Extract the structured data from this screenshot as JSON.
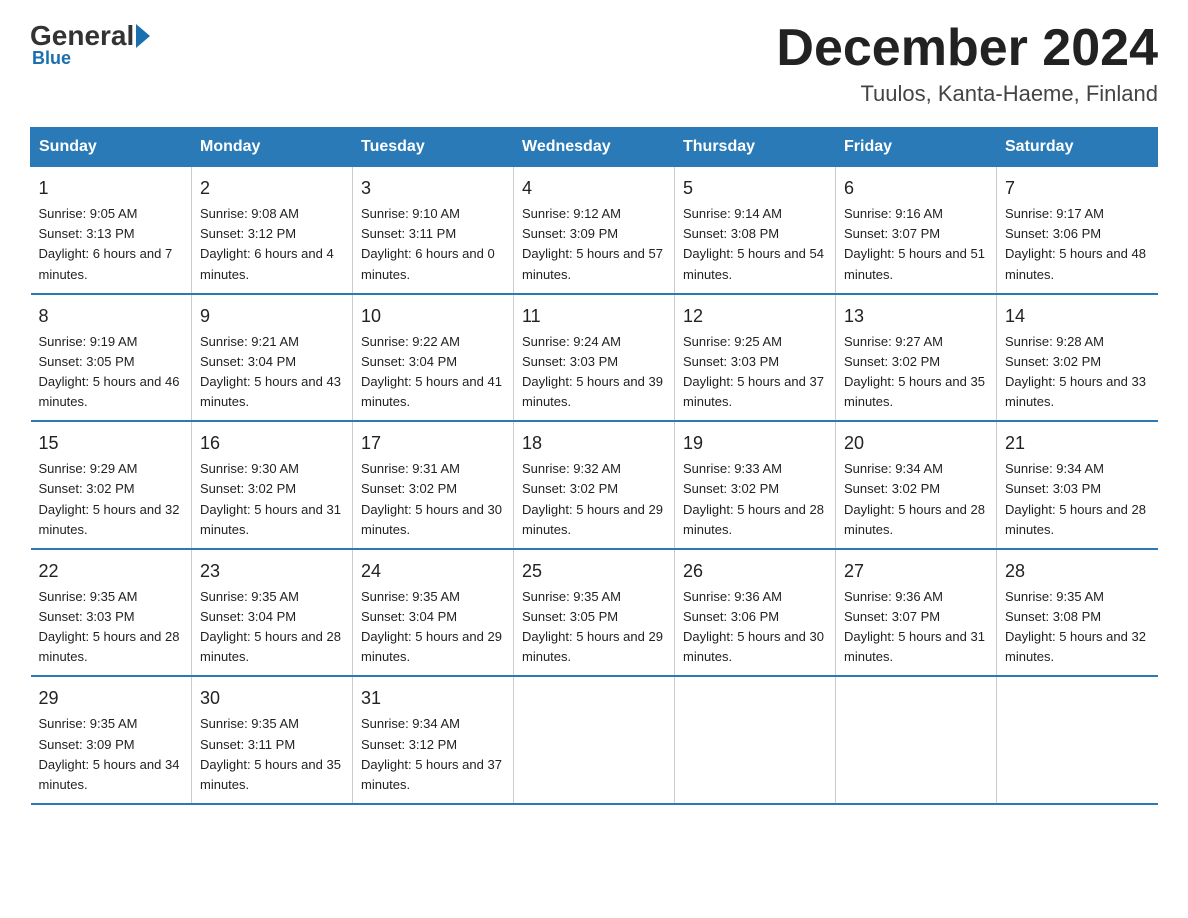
{
  "logo": {
    "general": "General",
    "blue": "Blue"
  },
  "header": {
    "month": "December 2024",
    "location": "Tuulos, Kanta-Haeme, Finland"
  },
  "days_of_week": [
    "Sunday",
    "Monday",
    "Tuesday",
    "Wednesday",
    "Thursday",
    "Friday",
    "Saturday"
  ],
  "weeks": [
    [
      {
        "num": "1",
        "sunrise": "9:05 AM",
        "sunset": "3:13 PM",
        "daylight": "6 hours and 7 minutes."
      },
      {
        "num": "2",
        "sunrise": "9:08 AM",
        "sunset": "3:12 PM",
        "daylight": "6 hours and 4 minutes."
      },
      {
        "num": "3",
        "sunrise": "9:10 AM",
        "sunset": "3:11 PM",
        "daylight": "6 hours and 0 minutes."
      },
      {
        "num": "4",
        "sunrise": "9:12 AM",
        "sunset": "3:09 PM",
        "daylight": "5 hours and 57 minutes."
      },
      {
        "num": "5",
        "sunrise": "9:14 AM",
        "sunset": "3:08 PM",
        "daylight": "5 hours and 54 minutes."
      },
      {
        "num": "6",
        "sunrise": "9:16 AM",
        "sunset": "3:07 PM",
        "daylight": "5 hours and 51 minutes."
      },
      {
        "num": "7",
        "sunrise": "9:17 AM",
        "sunset": "3:06 PM",
        "daylight": "5 hours and 48 minutes."
      }
    ],
    [
      {
        "num": "8",
        "sunrise": "9:19 AM",
        "sunset": "3:05 PM",
        "daylight": "5 hours and 46 minutes."
      },
      {
        "num": "9",
        "sunrise": "9:21 AM",
        "sunset": "3:04 PM",
        "daylight": "5 hours and 43 minutes."
      },
      {
        "num": "10",
        "sunrise": "9:22 AM",
        "sunset": "3:04 PM",
        "daylight": "5 hours and 41 minutes."
      },
      {
        "num": "11",
        "sunrise": "9:24 AM",
        "sunset": "3:03 PM",
        "daylight": "5 hours and 39 minutes."
      },
      {
        "num": "12",
        "sunrise": "9:25 AM",
        "sunset": "3:03 PM",
        "daylight": "5 hours and 37 minutes."
      },
      {
        "num": "13",
        "sunrise": "9:27 AM",
        "sunset": "3:02 PM",
        "daylight": "5 hours and 35 minutes."
      },
      {
        "num": "14",
        "sunrise": "9:28 AM",
        "sunset": "3:02 PM",
        "daylight": "5 hours and 33 minutes."
      }
    ],
    [
      {
        "num": "15",
        "sunrise": "9:29 AM",
        "sunset": "3:02 PM",
        "daylight": "5 hours and 32 minutes."
      },
      {
        "num": "16",
        "sunrise": "9:30 AM",
        "sunset": "3:02 PM",
        "daylight": "5 hours and 31 minutes."
      },
      {
        "num": "17",
        "sunrise": "9:31 AM",
        "sunset": "3:02 PM",
        "daylight": "5 hours and 30 minutes."
      },
      {
        "num": "18",
        "sunrise": "9:32 AM",
        "sunset": "3:02 PM",
        "daylight": "5 hours and 29 minutes."
      },
      {
        "num": "19",
        "sunrise": "9:33 AM",
        "sunset": "3:02 PM",
        "daylight": "5 hours and 28 minutes."
      },
      {
        "num": "20",
        "sunrise": "9:34 AM",
        "sunset": "3:02 PM",
        "daylight": "5 hours and 28 minutes."
      },
      {
        "num": "21",
        "sunrise": "9:34 AM",
        "sunset": "3:03 PM",
        "daylight": "5 hours and 28 minutes."
      }
    ],
    [
      {
        "num": "22",
        "sunrise": "9:35 AM",
        "sunset": "3:03 PM",
        "daylight": "5 hours and 28 minutes."
      },
      {
        "num": "23",
        "sunrise": "9:35 AM",
        "sunset": "3:04 PM",
        "daylight": "5 hours and 28 minutes."
      },
      {
        "num": "24",
        "sunrise": "9:35 AM",
        "sunset": "3:04 PM",
        "daylight": "5 hours and 29 minutes."
      },
      {
        "num": "25",
        "sunrise": "9:35 AM",
        "sunset": "3:05 PM",
        "daylight": "5 hours and 29 minutes."
      },
      {
        "num": "26",
        "sunrise": "9:36 AM",
        "sunset": "3:06 PM",
        "daylight": "5 hours and 30 minutes."
      },
      {
        "num": "27",
        "sunrise": "9:36 AM",
        "sunset": "3:07 PM",
        "daylight": "5 hours and 31 minutes."
      },
      {
        "num": "28",
        "sunrise": "9:35 AM",
        "sunset": "3:08 PM",
        "daylight": "5 hours and 32 minutes."
      }
    ],
    [
      {
        "num": "29",
        "sunrise": "9:35 AM",
        "sunset": "3:09 PM",
        "daylight": "5 hours and 34 minutes."
      },
      {
        "num": "30",
        "sunrise": "9:35 AM",
        "sunset": "3:11 PM",
        "daylight": "5 hours and 35 minutes."
      },
      {
        "num": "31",
        "sunrise": "9:34 AM",
        "sunset": "3:12 PM",
        "daylight": "5 hours and 37 minutes."
      },
      null,
      null,
      null,
      null
    ]
  ]
}
